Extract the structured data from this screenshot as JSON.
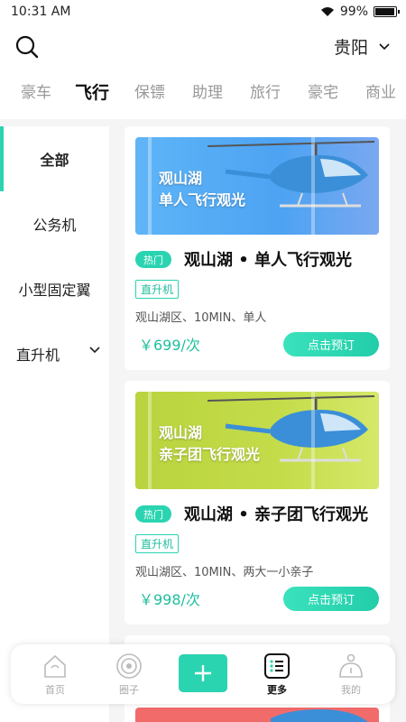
{
  "status": {
    "time": "10:31 AM",
    "battery": "99%"
  },
  "header": {
    "city": "贵阳"
  },
  "tabs": [
    {
      "label": "豪车",
      "active": false
    },
    {
      "label": "飞行",
      "active": true
    },
    {
      "label": "保镖",
      "active": false
    },
    {
      "label": "助理",
      "active": false
    },
    {
      "label": "旅行",
      "active": false
    },
    {
      "label": "豪宅",
      "active": false
    },
    {
      "label": "商业",
      "active": false
    }
  ],
  "sidebar": {
    "items": [
      {
        "label": "全部"
      },
      {
        "label": "公务机"
      },
      {
        "label": "小型固定翼"
      },
      {
        "label": "直升机"
      }
    ]
  },
  "cards": [
    {
      "banner_line1": "观山湖",
      "banner_line2": "单人飞行观光",
      "banner_color": "#4da3f2",
      "badge": "热门",
      "title": "观山湖 • 单人飞行观光",
      "tag": "直升机",
      "info": "观山湖区、10MIN、单人",
      "price": "￥699/次",
      "button": "点击预订"
    },
    {
      "banner_line1": "观山湖",
      "banner_line2": "亲子团飞行观光",
      "banner_color": "#c4dc4a",
      "badge": "热门",
      "title": "观山湖 • 亲子团飞行观光",
      "tag": "直升机",
      "info": "观山湖区、10MIN、两大一小亲子",
      "price": "￥998/次",
      "button": "点击预订"
    }
  ],
  "bottom_nav": [
    {
      "label": "首页",
      "icon": "home-icon"
    },
    {
      "label": "圈子",
      "icon": "circle-icon"
    },
    {
      "label": "",
      "icon": "plus-icon"
    },
    {
      "label": "更多",
      "icon": "list-icon"
    },
    {
      "label": "我的",
      "icon": "profile-icon"
    }
  ],
  "colors": {
    "accent": "#2ad4b0",
    "price": "#1fbf9e",
    "partial_banner": "#f26b6b"
  }
}
